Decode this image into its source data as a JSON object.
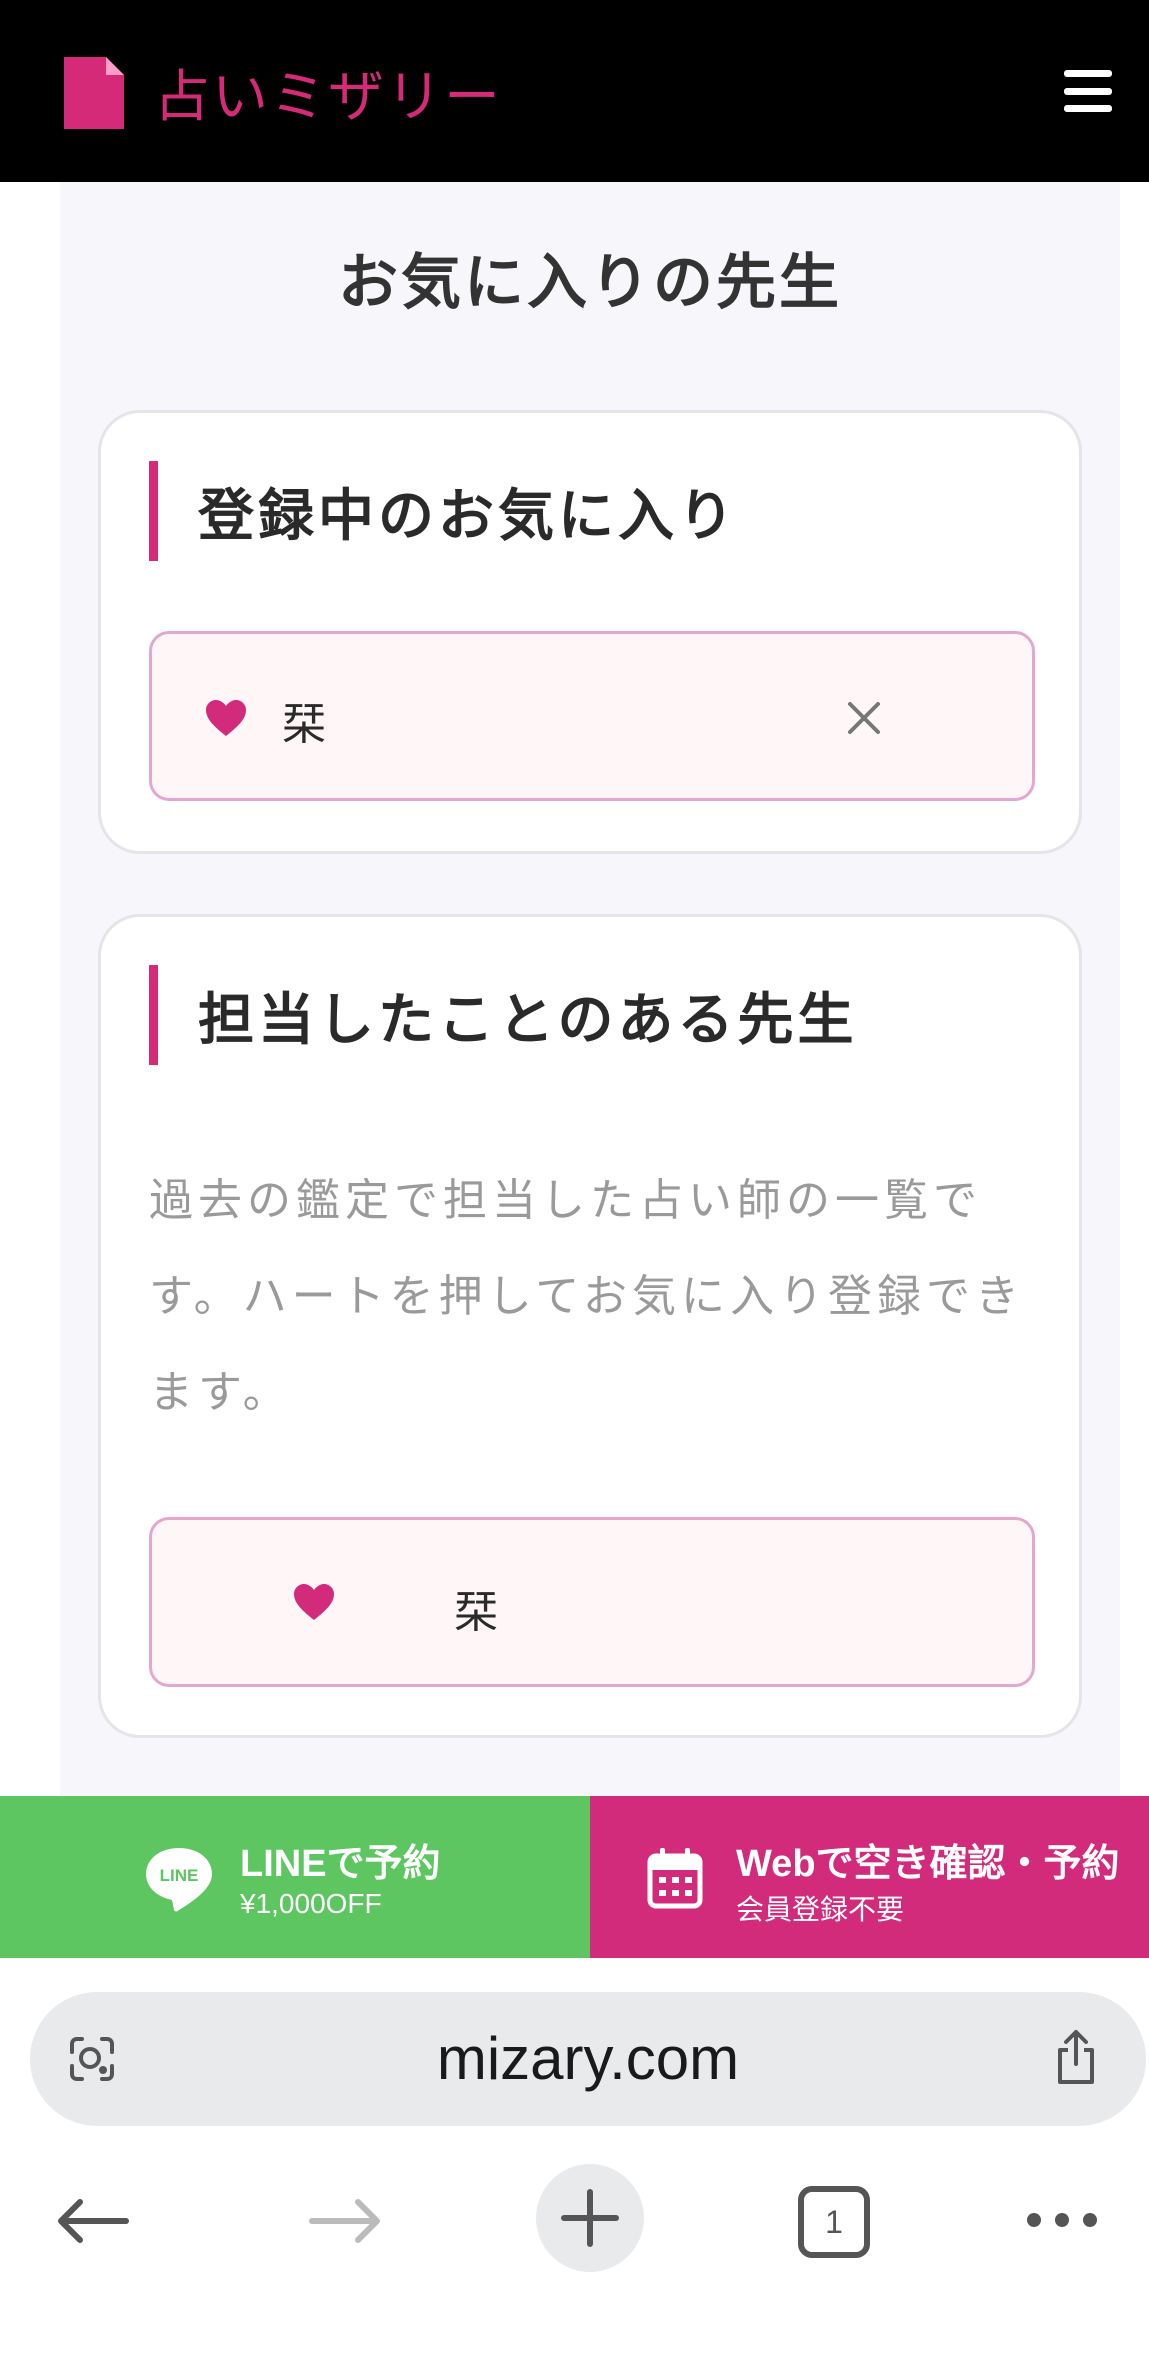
{
  "header": {
    "logo_text": "占いミザリー",
    "brand_color": "#d42a78",
    "menu_icon": "hamburger-menu-icon"
  },
  "main": {
    "title": "お気に入りの先生",
    "registered_section": {
      "heading": "登録中のお気に入り",
      "items": [
        {
          "name": "栞",
          "icon": "heart-icon",
          "action_icon": "close-icon"
        }
      ]
    },
    "history_section": {
      "heading": "担当したことのある先生",
      "description": "過去の鑑定で担当した占い師の一覧です。ハートを押してお気に入り登録できます。",
      "items": [
        {
          "name": "栞",
          "icon": "heart-icon"
        }
      ]
    }
  },
  "cta_bar": {
    "line": {
      "title": "LINEで予約",
      "subtitle": "¥1,000OFF",
      "icon": "line-icon",
      "color": "#5ec661"
    },
    "web": {
      "title": "Webで空き確認・予約",
      "subtitle": "会員登録不要",
      "icon": "calendar-icon",
      "color": "#d22b7c"
    }
  },
  "browser": {
    "url": "mizary.com",
    "tab_count": "1",
    "icons": [
      "lens-icon",
      "share-icon",
      "back-arrow-icon",
      "forward-arrow-icon",
      "plus-icon",
      "tabs-icon",
      "more-icon"
    ]
  }
}
